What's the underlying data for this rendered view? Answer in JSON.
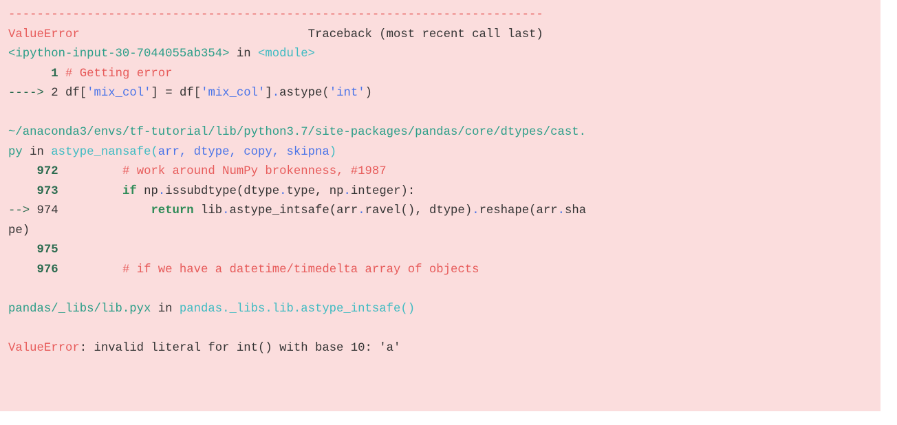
{
  "separator": "---------------------------------------------------------------------------",
  "header": {
    "error_name": "ValueError",
    "spacing": "                                ",
    "traceback_label": "Traceback (most recent call last)"
  },
  "frame1": {
    "location": "<ipython-input-30-7044055ab354>",
    "in": " in ",
    "module": "<module>",
    "line1": {
      "prefix": "      ",
      "num": "1",
      "space": " ",
      "comment": "# Getting error"
    },
    "line2": {
      "arrow": "----> ",
      "num": "2",
      "space": " ",
      "seg1": "df",
      "br1": "[",
      "str1": "'mix_col'",
      "br2": "]",
      "eq": " = ",
      "seg2": "df",
      "br3": "[",
      "str2": "'mix_col'",
      "br4": "]",
      "dot1": ".",
      "astype": "astype",
      "p1": "(",
      "str3": "'int'",
      "p2": ")"
    }
  },
  "blank": "",
  "frame2": {
    "path1": "~/anaconda3/envs/tf-tutorial/lib/python3.7/site-packages/pandas/core/dtypes/cast.",
    "path2": "py",
    "in": " in ",
    "func": "astype_nansafe",
    "p1": "(",
    "args": "arr, dtype, copy, skipna",
    "p2": ")",
    "l972": {
      "prefix": "    ",
      "num": "972",
      "sp": "         ",
      "comment": "# work around NumPy brokenness, #1987"
    },
    "l973": {
      "prefix": "    ",
      "num": "973",
      "sp": "         ",
      "kw_if": "if",
      "s1": " np",
      "d1": ".",
      "s2": "issubdtype",
      "p1": "(",
      "s3": "dtype",
      "d2": ".",
      "s4": "type",
      "c1": ",",
      "s5": " np",
      "d3": ".",
      "s6": "integer",
      "p2": "):"
    },
    "l974a": {
      "arrow": "--> ",
      "num": "974",
      "sp": "             ",
      "kw_ret": "return",
      "s1": " lib",
      "d1": ".",
      "s2": "astype_intsafe",
      "p1": "(",
      "s3": "arr",
      "d2": ".",
      "s4": "ravel",
      "p2": "(),",
      "s5": " dtype",
      "p3": ")",
      "d3": ".",
      "s6": "reshape",
      "p4": "(",
      "s7": "arr",
      "d4": ".",
      "s8": "sha"
    },
    "l974b": {
      "tail": "pe",
      "p": ")"
    },
    "l975": {
      "prefix": "    ",
      "num": "975",
      "rest": ""
    },
    "l976": {
      "prefix": "    ",
      "num": "976",
      "sp": "         ",
      "comment": "# if we have a datetime/timedelta array of objects"
    }
  },
  "frame3": {
    "path": "pandas/_libs/lib.pyx",
    "in": " in ",
    "full": "pandas._libs.lib.astype_intsafe",
    "paren": "()"
  },
  "final": {
    "err": "ValueError",
    "colon": ":",
    "msg": " invalid literal for int() with base 10: 'a'"
  }
}
